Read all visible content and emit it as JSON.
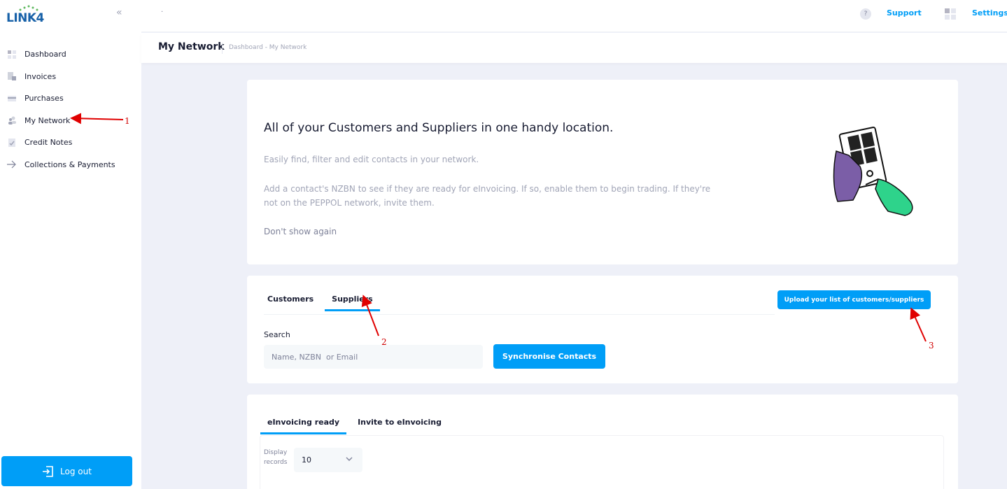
{
  "brand": {
    "logo_text": "LINK4"
  },
  "sidebar": {
    "items": [
      {
        "label": "Dashboard",
        "icon": "dashboard-icon"
      },
      {
        "label": "Invoices",
        "icon": "invoices-icon"
      },
      {
        "label": "Purchases",
        "icon": "purchases-icon"
      },
      {
        "label": "My Network",
        "icon": "network-icon"
      },
      {
        "label": "Credit Notes",
        "icon": "credit-notes-icon"
      },
      {
        "label": "Collections & Payments",
        "icon": "arrow-right-icon"
      }
    ],
    "logout_label": "Log out"
  },
  "topbar": {
    "dot": "·",
    "help": "?",
    "support": "Support",
    "settings": "Settings"
  },
  "toolbar": {
    "title": "My Network",
    "breadcrumb": "Dashboard - My Network"
  },
  "intro": {
    "heading": "All of your Customers and Suppliers in one handy location.",
    "line1": "Easily find, filter and edit contacts in your network.",
    "line2": "Add a contact's NZBN to see if they are ready for eInvoicing. If so, enable them to begin trading. If they're not on the PEPPOL network, invite them.",
    "dismiss": "Don't show again"
  },
  "network": {
    "tabs": [
      "Customers",
      "Suppliers"
    ],
    "active_tab": "Suppliers",
    "upload_label": "Upload your list of customers/suppliers",
    "search_label": "Search",
    "search_placeholder": "Name, NZBN  or Email",
    "sync_label": "Synchronise Contacts"
  },
  "einvoicing": {
    "tabs": [
      "eInvoicing ready",
      "Invite to eInvoicing"
    ],
    "active_tab": "eInvoicing ready",
    "display_label_1": "Display",
    "display_label_2": "records",
    "records_value": "10"
  },
  "annotations": [
    "1",
    "2",
    "3"
  ],
  "colors": {
    "primary": "#009ef7",
    "annotation": "#d00000",
    "logo": "#1761a8"
  }
}
